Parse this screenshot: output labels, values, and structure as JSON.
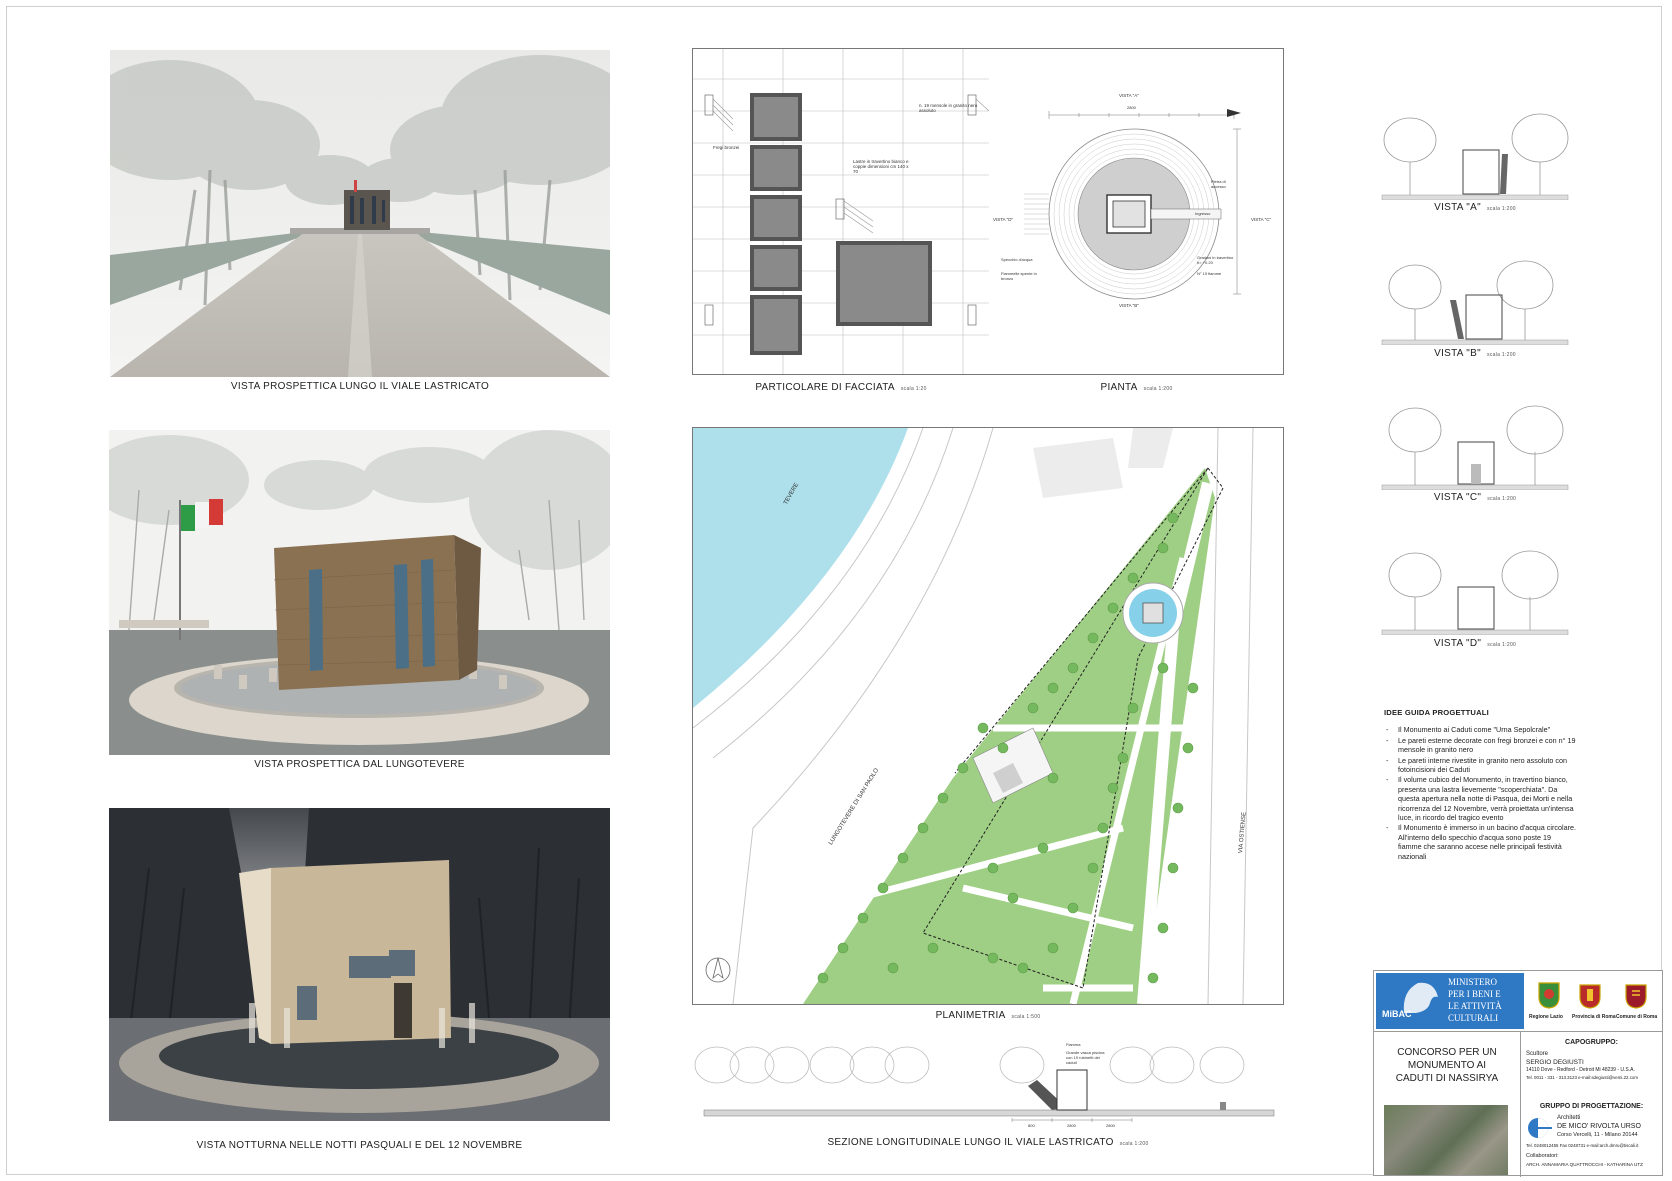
{
  "panels": {
    "view_avenue": {
      "caption": "VISTA PROSPETTICA LUNGO IL VIALE LASTRICATO"
    },
    "view_river": {
      "caption": "VISTA PROSPETTICA DAL LUNGOTEVERE"
    },
    "view_night": {
      "caption": "VISTA NOTTURNA NELLE NOTTI PASQUALI E DEL 12 NOVEMBRE"
    },
    "facade": {
      "caption": "PARTICOLARE DI FACCIATA",
      "scale": "scala 1:20",
      "notes": [
        "n. 19 mensole in granito nero assoluto",
        "Fregi bronzei",
        "Lastre in travertino bianco e coppie dimensioni cm 140 x 70"
      ]
    },
    "plan": {
      "caption": "PIANTA",
      "scale": "scala 1:200",
      "labels": {
        "view_a": "VISTA \"A\"",
        "view_b": "VISTA \"B\"",
        "view_c": "VISTA \"C\"",
        "view_d": "VISTA \"D\"",
        "notes": [
          "Pietra di accesso",
          "Ingresso",
          "Specchio d'acqua",
          "Fiammelle spente in bronzo",
          "Gradoni in travertino h= +0.20",
          "N° 19 fiamme"
        ],
        "dims": [
          "2800",
          "280",
          "280",
          "280",
          "280",
          "280",
          "280"
        ]
      }
    },
    "site": {
      "caption": "PLANIMETRIA",
      "scale": "scala 1:500",
      "labels": {
        "river": "TEVERE",
        "lungotevere": "LUNGOTEVERE DI SAN PAOLO",
        "ostiense": "VIA OSTIENSE"
      }
    },
    "section": {
      "caption": "SEZIONE LONGITUDINALE LUNGO IL VIALE LASTRICATO",
      "scale": "scala 1:200",
      "notes": [
        "Fiamma",
        "Grande vasca piscina con 19 rubinetti dei caduti"
      ],
      "dims": [
        "800",
        "2800",
        "2800"
      ]
    }
  },
  "elevations": [
    {
      "caption": "VISTA \"A\"",
      "scale": "scala 1:200"
    },
    {
      "caption": "VISTA \"B\"",
      "scale": "scala 1:200"
    },
    {
      "caption": "VISTA \"C\"",
      "scale": "scala 1:200"
    },
    {
      "caption": "VISTA \"D\"",
      "scale": "scala 1:200"
    }
  ],
  "ideas": {
    "title": "IDEE GUIDA PROGETTUALI",
    "items": [
      "Il Monumento ai Caduti come \"Urna Sepolcrale\"",
      "Le pareti esterne decorate con fregi bronzei e con n° 19 mensole in granito nero",
      "Le pareti interne rivestite in granito nero assoluto con fotoincisioni dei Caduti",
      "Il volume cubico del Monumento, in travertino bianco, presenta una lastra lievemente \"scoperchiata\". Da questa apertura nella notte di Pasqua, dei Morti e nella ricorrenza del 12 Novembre, verrà proiettata un'intensa luce, in ricordo del tragico evento",
      "Il Monumento è immerso in un bacino d'acqua circolare. All'interno dello specchio d'acqua sono poste 19 fiamme che saranno accese nelle principali festività nazionali"
    ]
  },
  "title_block": {
    "ministry_acronym": "MiBAC",
    "ministry_lines": [
      "MINISTERO",
      "PER I BENI E",
      "LE ATTIVITÀ",
      "CULTURALI"
    ],
    "logos": [
      "Regione Lazio",
      "Provincia di Roma",
      "Comune di Roma"
    ],
    "competition": [
      "CONCORSO PER UN",
      "MONUMENTO AI",
      "CADUTI DI NASSIRYA"
    ],
    "lead_title": "CAPOGRUPPO:",
    "lead_role": "Scultore",
    "lead_name": "SERGIO DEGIUSTI",
    "lead_address": "14110 Dove - Redford - Detroit Mi 48239 - U.S.A.",
    "lead_contact": "Tel. 0011 - 331 - 313.3123 e-mail:sdegiusti@vemi.22.com",
    "group_title": "GRUPPO DI PROGETTAZIONE:",
    "group_role": "Architetti",
    "group_name": "DE MICO' RIVOLTA URSO",
    "group_address": "Corso Vercelli, 11 - Milano 20144",
    "group_contact": "Tel. 0248012455 Fax 0248731 e-mail:arch.dmru@tiscali.it",
    "collab_title": "Collaboratori:",
    "collab_names": "ARCH. ANNAMARIA QUATTROCCHI - KATHARINA UTZ"
  }
}
